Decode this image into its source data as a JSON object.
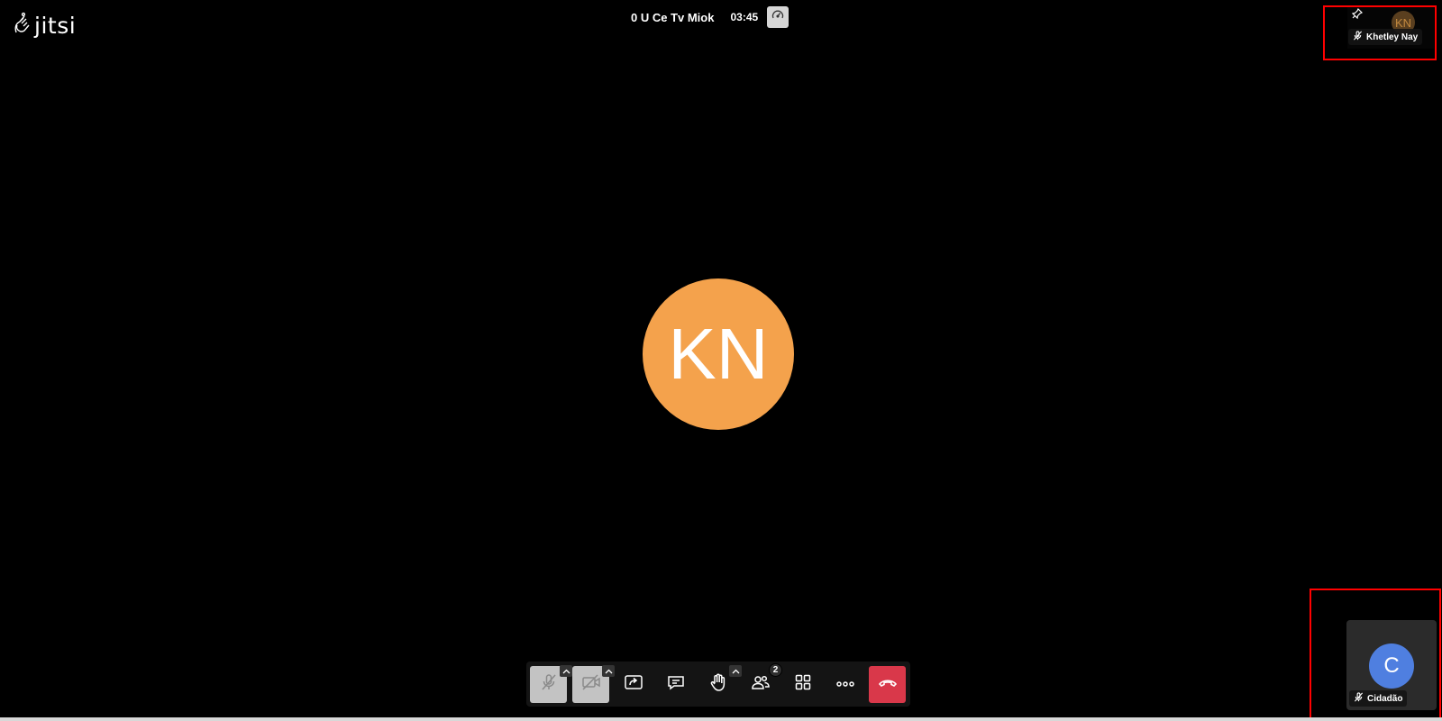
{
  "logo": {
    "text": "jitsi",
    "icon": "jitsi-hands-icon"
  },
  "header": {
    "meeting_title": "0 U Ce Tv Miok",
    "timer": "03:45",
    "connection_icon": "speedometer-icon"
  },
  "main_stage": {
    "initials": "KN",
    "color": "#f4a24c"
  },
  "filmstrip": {
    "top": {
      "name": "Khetley Nay",
      "initials": "KN",
      "muted_icon": "mic-muted-icon",
      "pin_icon": "pin-icon"
    },
    "local": {
      "name": "Cidadão",
      "initials": "C",
      "color": "#4f7fe0",
      "muted_icon": "mic-muted-icon"
    }
  },
  "toolbar": {
    "buttons": [
      {
        "name": "microphone",
        "icon": "mic-muted-icon",
        "state": "disabled",
        "has_menu": true
      },
      {
        "name": "camera",
        "icon": "camera-off-icon",
        "state": "disabled",
        "has_menu": true
      },
      {
        "name": "share-screen",
        "icon": "screen-share-icon"
      },
      {
        "name": "chat",
        "icon": "chat-icon"
      },
      {
        "name": "raise-hand",
        "icon": "hand-icon",
        "has_menu": true
      },
      {
        "name": "participants",
        "icon": "participants-icon",
        "badge": "2"
      },
      {
        "name": "tile-view",
        "icon": "grid-icon"
      },
      {
        "name": "more",
        "icon": "more-dots-icon"
      },
      {
        "name": "hangup",
        "icon": "phone-hangup-icon",
        "color": "#d9384a"
      }
    ]
  },
  "colors": {
    "highlight": "#ff0000",
    "background": "#000000"
  }
}
